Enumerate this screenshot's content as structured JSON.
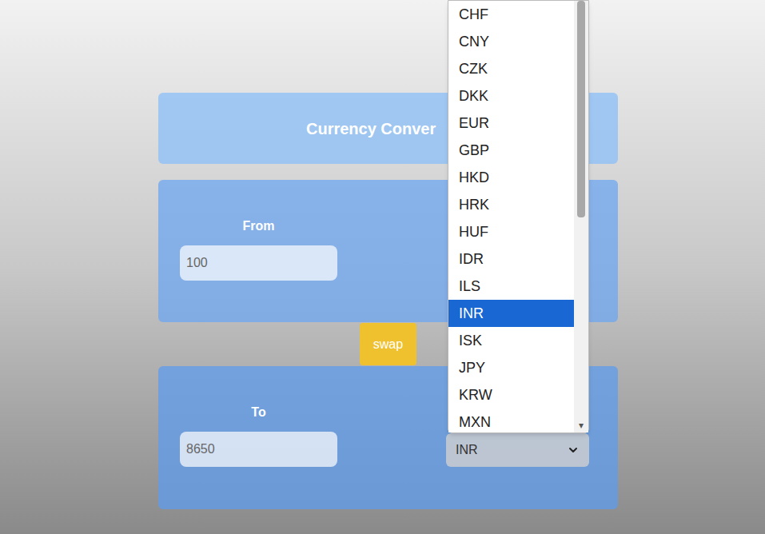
{
  "header": {
    "title": "Currency Conver"
  },
  "from": {
    "label": "From",
    "amount": "100"
  },
  "swap_button": {
    "label": "swap"
  },
  "to": {
    "label": "To",
    "amount": "8650",
    "currency": "INR"
  },
  "currency_dropdown": {
    "open": true,
    "options": [
      {
        "label": "CHF",
        "selected": false
      },
      {
        "label": "CNY",
        "selected": false
      },
      {
        "label": "CZK",
        "selected": false
      },
      {
        "label": "DKK",
        "selected": false
      },
      {
        "label": "EUR",
        "selected": false
      },
      {
        "label": "GBP",
        "selected": false
      },
      {
        "label": "HKD",
        "selected": false
      },
      {
        "label": "HRK",
        "selected": false
      },
      {
        "label": "HUF",
        "selected": false
      },
      {
        "label": "IDR",
        "selected": false
      },
      {
        "label": "ILS",
        "selected": false
      },
      {
        "label": "INR",
        "selected": true
      },
      {
        "label": "ISK",
        "selected": false
      },
      {
        "label": "JPY",
        "selected": false
      },
      {
        "label": "KRW",
        "selected": false
      },
      {
        "label": "MXN",
        "selected": false
      }
    ],
    "scrollbar": {
      "offset": 0,
      "thumb": 0.52,
      "down_arrow": "▾"
    }
  }
}
